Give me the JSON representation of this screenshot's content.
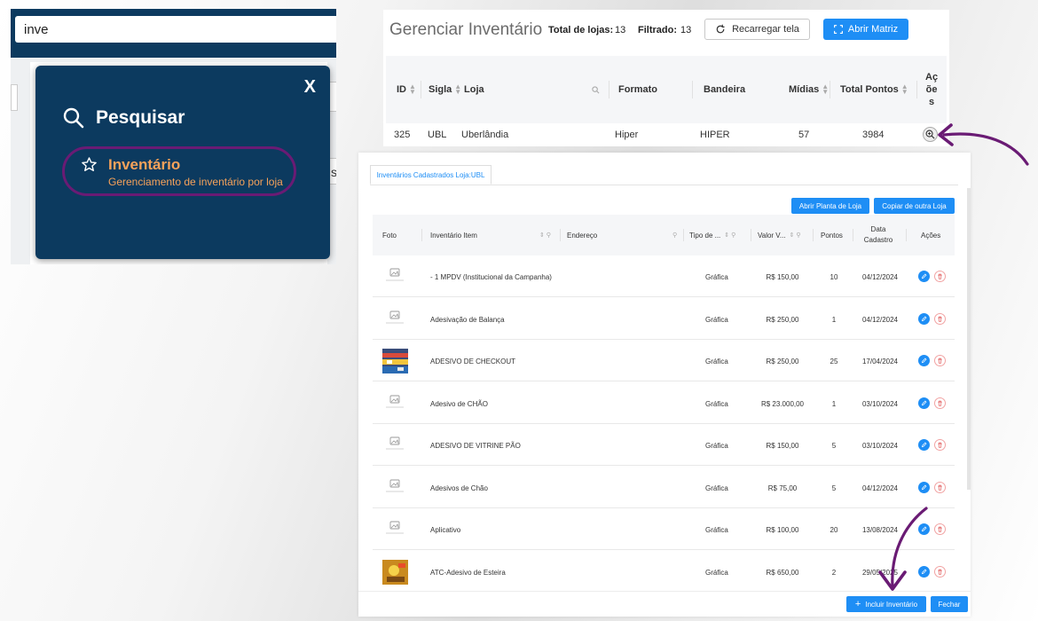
{
  "search_panel": {
    "query": "inve",
    "modal": {
      "close_label": "X",
      "title": "Pesquisar",
      "result": {
        "title": "Inventário",
        "subtitle": "Gerenciamento de inventário por loja"
      }
    },
    "ghost_text": "s"
  },
  "manage_panel": {
    "title": "Gerenciar Inventário",
    "total_label": "Total de lojas:",
    "total_value": "13",
    "filtered_label": "Filtrado:",
    "filtered_value": "13",
    "reload_label": "Recarregar tela",
    "matrix_label": "Abrir Matriz",
    "columns": {
      "id": "ID",
      "sigla": "Sigla",
      "loja": "Loja",
      "formato": "Formato",
      "bandeira": "Bandeira",
      "midias": "Mídias",
      "total_pontos": "Total Pontos",
      "acoes_1": "Aç",
      "acoes_2": "õe",
      "acoes_3": "s"
    },
    "row": {
      "id": "325",
      "sigla": "UBL",
      "loja": "Uberlândia",
      "formato": "Hiper",
      "bandeira": "HIPER",
      "midias": "57",
      "total_pontos": "3984"
    }
  },
  "inventory_panel": {
    "tab_label": "Inventários Cadastrados Loja:UBL",
    "btn_planta": "Abrir Planta de Loja",
    "btn_copiar": "Copiar de outra Loja",
    "columns": {
      "foto": "Foto",
      "item": "Inventário Item",
      "endereco": "Endereço",
      "tipo": "Tipo de ...",
      "valor": "Valor V...",
      "pontos": "Pontos",
      "data_1": "Data",
      "data_2": "Cadastro",
      "acoes": "Ações"
    },
    "rows": [
      {
        "item": "- 1 MPDV (Institucional da Campanha)",
        "tipo": "Gráfica",
        "valor": "R$ 150,00",
        "pontos": "10",
        "data": "04/12/2024",
        "photo": "placeholder"
      },
      {
        "item": "Adesivação de Balança",
        "tipo": "Gráfica",
        "valor": "R$ 250,00",
        "pontos": "1",
        "data": "04/12/2024",
        "photo": "placeholder"
      },
      {
        "item": "ADESIVO DE CHECKOUT",
        "tipo": "Gráfica",
        "valor": "R$ 250,00",
        "pontos": "25",
        "data": "17/04/2024",
        "photo": "checkout-photo"
      },
      {
        "item": "Adesivo de CHÃO",
        "tipo": "Gráfica",
        "valor": "R$ 23.000,00",
        "pontos": "1",
        "data": "03/10/2024",
        "photo": "placeholder"
      },
      {
        "item": "ADESIVO DE VITRINE PÃO",
        "tipo": "Gráfica",
        "valor": "R$ 150,00",
        "pontos": "5",
        "data": "03/10/2024",
        "photo": "placeholder"
      },
      {
        "item": "Adesivos de Chão",
        "tipo": "Gráfica",
        "valor": "R$ 75,00",
        "pontos": "5",
        "data": "04/12/2024",
        "photo": "placeholder"
      },
      {
        "item": "Aplicativo",
        "tipo": "Gráfica",
        "valor": "R$ 100,00",
        "pontos": "20",
        "data": "13/08/2024",
        "photo": "placeholder"
      },
      {
        "item": "ATC-Adesivo de Esteira",
        "tipo": "Gráfica",
        "valor": "R$ 650,00",
        "pontos": "2",
        "data": "29/05/2025",
        "photo": "esteira-photo"
      }
    ],
    "btn_incluir": "Incluir Inventário",
    "btn_fechar": "Fechar"
  },
  "colors": {
    "navy": "#0c3a5f",
    "highlight_orange": "#f6a25a",
    "annotation_purple": "#6a1b74",
    "primary_blue": "#1e8ef5",
    "delete_red": "#e05555"
  }
}
